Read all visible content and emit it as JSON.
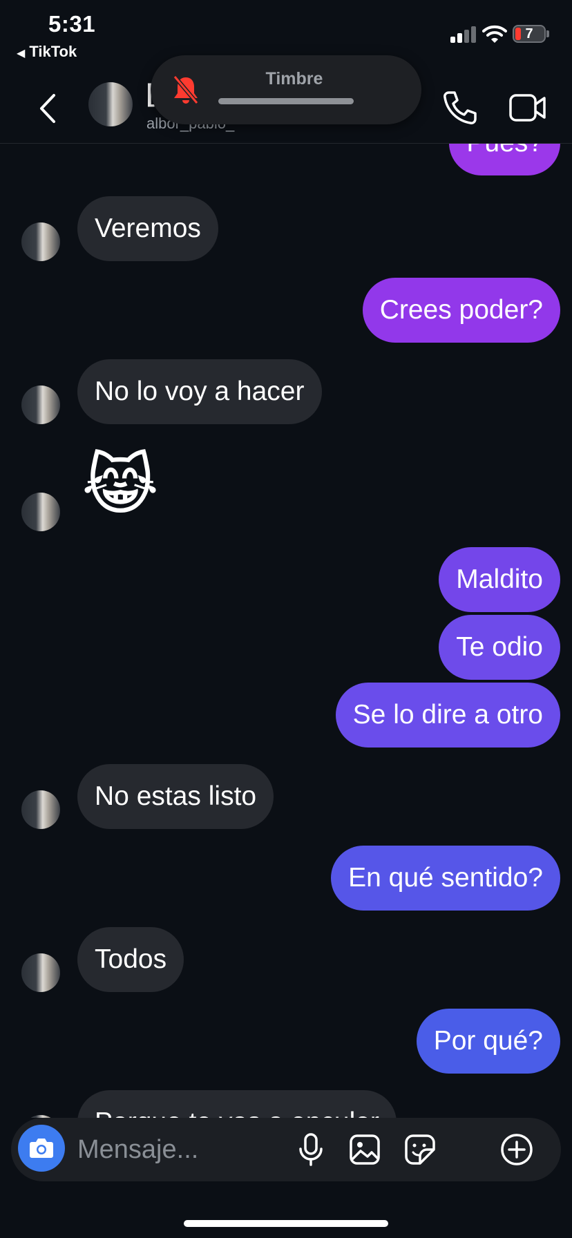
{
  "status_bar": {
    "time": "5:31",
    "back_app": "TikTok",
    "battery_level": "7",
    "battery_color": "#ff3b30"
  },
  "header": {
    "name_initial": "[",
    "username": "albor_pablo_",
    "back_icon": "chevron-left-icon",
    "call_icon": "phone-icon",
    "video_icon": "video-camera-icon"
  },
  "ringer": {
    "label": "Timbre",
    "icon": "bell-slash-icon",
    "icon_color": "#ff3b30"
  },
  "messages": [
    {
      "from": "me",
      "text": "Pues?",
      "color": "#9b38ea"
    },
    {
      "from": "them",
      "text": "Veremos"
    },
    {
      "from": "me",
      "text": "Crees poder?",
      "color": "#9238ea"
    },
    {
      "from": "them",
      "text": "No lo voy a hacer"
    },
    {
      "from": "them",
      "text": "😹",
      "kind": "emoji"
    },
    {
      "from": "me",
      "text": "Maldito",
      "color": "#7446ea"
    },
    {
      "from": "me",
      "text": "Te odio",
      "color": "#6e4bea"
    },
    {
      "from": "me",
      "text": "Se lo dire a otro",
      "color": "#6a4deb"
    },
    {
      "from": "them",
      "text": "No estas listo"
    },
    {
      "from": "me",
      "text": "En qué sentido?",
      "color": "#5656e8"
    },
    {
      "from": "them",
      "text": "Todos"
    },
    {
      "from": "me",
      "text": "Por qué?",
      "color": "#4a5de8"
    },
    {
      "from": "them",
      "text": "Porque te vas a enculer"
    }
  ],
  "composer": {
    "placeholder": "Mensaje...",
    "camera_color": "#3d7cf0",
    "icons": [
      "microphone-icon",
      "image-icon",
      "sticker-icon",
      "plus-circle-icon"
    ]
  }
}
